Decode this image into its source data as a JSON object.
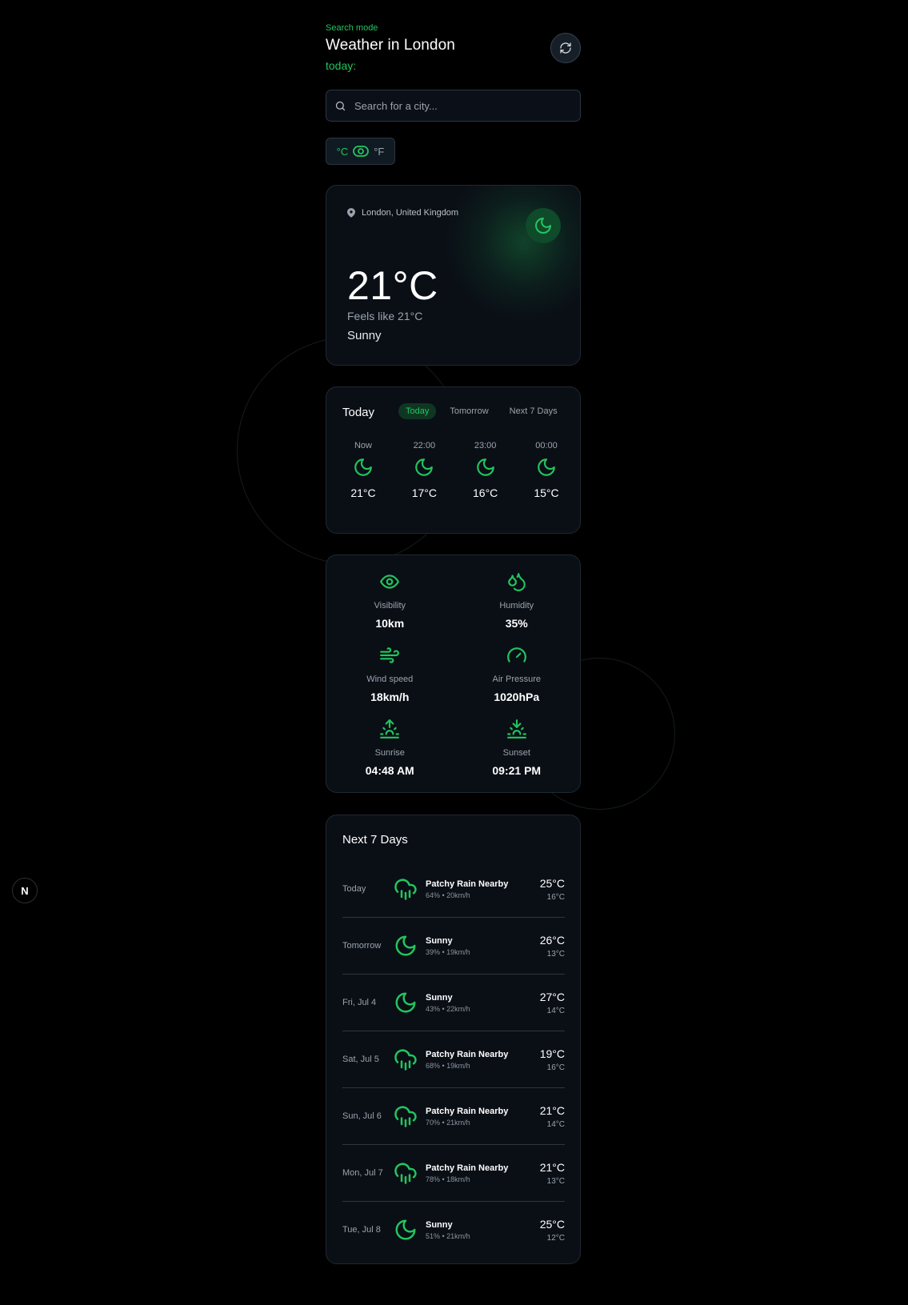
{
  "header": {
    "mode": "Search mode",
    "title": "Weather in London",
    "subtitle": "today:"
  },
  "search": {
    "placeholder": "Search for a city..."
  },
  "units": {
    "celsius": "°C",
    "fahrenheit": "°F"
  },
  "current": {
    "location": "London, United Kingdom",
    "temperature": "21°C",
    "feels_like": "Feels like 21°C",
    "condition": "Sunny"
  },
  "hourly": {
    "title": "Today",
    "tabs": [
      "Today",
      "Tomorrow",
      "Next 7 Days"
    ],
    "items": [
      {
        "time": "Now",
        "temp": "21°C",
        "icon": "moon-icon"
      },
      {
        "time": "22:00",
        "temp": "17°C",
        "icon": "moon-icon"
      },
      {
        "time": "23:00",
        "temp": "16°C",
        "icon": "moon-icon"
      },
      {
        "time": "00:00",
        "temp": "15°C",
        "icon": "moon-icon"
      }
    ]
  },
  "details": [
    {
      "label": "Visibility",
      "value": "10km",
      "icon": "eye-icon"
    },
    {
      "label": "Humidity",
      "value": "35%",
      "icon": "droplets-icon"
    },
    {
      "label": "Wind speed",
      "value": "18km/h",
      "icon": "wind-icon"
    },
    {
      "label": "Air Pressure",
      "value": "1020hPa",
      "icon": "gauge-icon"
    },
    {
      "label": "Sunrise",
      "value": "04:48 AM",
      "icon": "sunrise-icon"
    },
    {
      "label": "Sunset",
      "value": "09:21 PM",
      "icon": "sunset-icon"
    }
  ],
  "forecast": {
    "title": "Next 7 Days",
    "days": [
      {
        "day": "Today",
        "condition": "Patchy Rain Nearby",
        "meta": "64% • 20km/h",
        "high": "25°C",
        "low": "16°C",
        "icon": "cloud-rain-icon"
      },
      {
        "day": "Tomorrow",
        "condition": "Sunny",
        "meta": "39% • 19km/h",
        "high": "26°C",
        "low": "13°C",
        "icon": "moon-icon"
      },
      {
        "day": "Fri, Jul 4",
        "condition": "Sunny",
        "meta": "43% • 22km/h",
        "high": "27°C",
        "low": "14°C",
        "icon": "moon-icon"
      },
      {
        "day": "Sat, Jul 5",
        "condition": "Patchy Rain Nearby",
        "meta": "68% • 19km/h",
        "high": "19°C",
        "low": "16°C",
        "icon": "cloud-rain-icon"
      },
      {
        "day": "Sun, Jul 6",
        "condition": "Patchy Rain Nearby",
        "meta": "70% • 21km/h",
        "high": "21°C",
        "low": "14°C",
        "icon": "cloud-rain-icon"
      },
      {
        "day": "Mon, Jul 7",
        "condition": "Patchy Rain Nearby",
        "meta": "78% • 18km/h",
        "high": "21°C",
        "low": "13°C",
        "icon": "cloud-rain-icon"
      },
      {
        "day": "Tue, Jul 8",
        "condition": "Sunny",
        "meta": "51% • 21km/h",
        "high": "25°C",
        "low": "12°C",
        "icon": "moon-icon"
      }
    ]
  },
  "badge": {
    "letter": "N"
  },
  "colors": {
    "accent": "#22c55e",
    "background": "#000000",
    "card": "#0a0f16"
  }
}
